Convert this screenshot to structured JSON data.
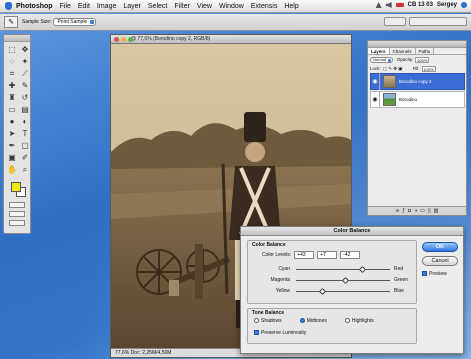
{
  "menubar": {
    "app": "Photoshop",
    "items": [
      "File",
      "Edit",
      "Image",
      "Layer",
      "Select",
      "Filter",
      "View",
      "Window",
      "Extensis",
      "Help"
    ],
    "right_text": "CB 13 03",
    "user": "Sergey"
  },
  "optbar": {
    "sample_size_label": "Sample Size:",
    "sample_size_value": "Point Sample"
  },
  "document": {
    "title": "@ 77,6% (Borodino copy 2, RGB/8)",
    "zoom": "77,6%",
    "status": "77,6%   Doc: 2,25M/4,50M"
  },
  "layers": {
    "tabs": [
      "Layers",
      "Channels",
      "Paths"
    ],
    "blend_mode": "Normal",
    "opacity_label": "Opacity:",
    "opacity": "100%",
    "lock_label": "Lock:",
    "fill_label": "Fill:",
    "fill": "100%",
    "items": [
      {
        "name": "Borodino copy 2",
        "active": true
      },
      {
        "name": "Borodino",
        "active": false
      }
    ]
  },
  "dialog": {
    "title": "Color Balance",
    "color_balance_group": "Color Balance",
    "color_levels_label": "Color Levels:",
    "levels": [
      "+43",
      "+7",
      "-42"
    ],
    "sliders": [
      {
        "left": "Cyan",
        "right": "Red",
        "value": 43
      },
      {
        "left": "Magenta",
        "right": "Green",
        "value": 7
      },
      {
        "left": "Yellow",
        "right": "Blue",
        "value": -42
      }
    ],
    "tone_balance_group": "Tone Balance",
    "tones": [
      "Shadows",
      "Midtones",
      "Highlights"
    ],
    "selected_tone": "Midtones",
    "preserve_luminosity_label": "Preserve Luminosity",
    "preserve_luminosity": true,
    "ok_label": "OK",
    "cancel_label": "Cancel",
    "preview_label": "Preview",
    "preview": true
  },
  "colors": {
    "desktop": "#3d77c8",
    "sepia": "#8a7352",
    "accent": "#3a6ed6",
    "foreground_swatch": "#f3e800"
  }
}
